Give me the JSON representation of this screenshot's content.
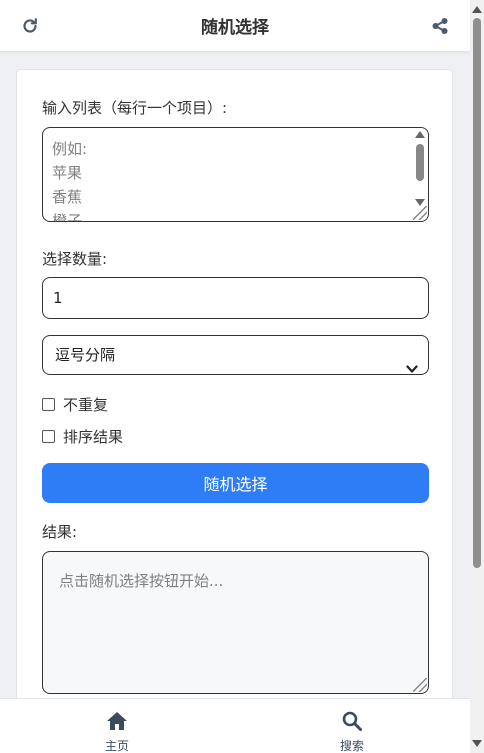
{
  "header": {
    "title": "随机选择",
    "left_icon": "refresh-icon",
    "right_icon": "share-icon"
  },
  "form": {
    "list_label": "输入列表（每行一个项目）:",
    "list_placeholder_lines": [
      "例如:",
      "苹果",
      "香蕉",
      "橙子"
    ],
    "count_label": "选择数量:",
    "count_value": "1",
    "separator_selected": "逗号分隔",
    "no_repeat_label": "不重复",
    "sort_label": "排序结果",
    "submit_label": "随机选择",
    "result_label": "结果:",
    "result_placeholder": "点击随机选择按钮开始..."
  },
  "bottom_nav": {
    "items": [
      {
        "label": "主页",
        "icon": "home-icon"
      },
      {
        "label": "搜索",
        "icon": "search-icon"
      }
    ]
  },
  "colors": {
    "accent": "#2f7df6",
    "header_text": "#333333",
    "icon": "#4a5a6b",
    "result_bg": "#f7f8fa"
  }
}
